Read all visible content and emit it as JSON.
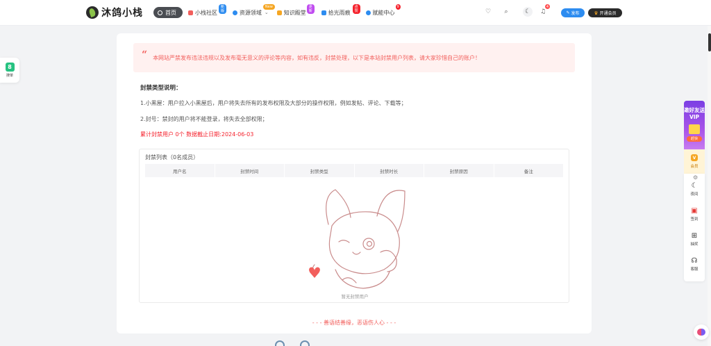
{
  "header": {
    "logo_text": "沐鸽小栈",
    "nav": {
      "home": "首页",
      "items": [
        {
          "label": "小栈社区",
          "badge": "新版",
          "badge_color": "#2d8cf0",
          "dot_color": "#f25f5c"
        },
        {
          "label": "资源领域",
          "badge": "New",
          "badge_color": "#f5a623",
          "dot_color": "#2d8cf0"
        },
        {
          "label": "知识殿堂",
          "badge": "更新",
          "badge_color": "#c04cf0",
          "dot_color": "#f5a623"
        },
        {
          "label": "拾光雨痕",
          "badge": "点赞",
          "badge_color": "#f5222d",
          "dot_color": "#2d8cf0"
        },
        {
          "label": "赋能中心",
          "badge": "9",
          "badge_color": "#f5222d",
          "dot_color": "#2d8cf0"
        }
      ]
    },
    "notification_count": "4",
    "publish_label": "发布",
    "vip_label": "开通会员"
  },
  "left_float": {
    "label": "搜单"
  },
  "main": {
    "notice": "本网站严禁发布违法违规以及发布毫无意义的评论等内容，如有违反，封禁处理，以下是本站封禁用户列表，请大家珍惜自己的账户！",
    "section_title": "封禁类型说明：",
    "lines": [
      "1.小黑屋：用户拉入小黑屋后，用户将失去所有的发布权限及大部分的操作权限，例如发帖、评论、下载等；",
      "2.封号：禁封的用户将不能登录，将失去全部权限；"
    ],
    "summary": "累计封禁用户 0个 数据截止日期:2024-06-03",
    "list": {
      "title": "封禁列表（0名成员）",
      "columns": [
        "用户名",
        "封禁时间",
        "封禁类型",
        "封禁时长",
        "封禁原因",
        "备注"
      ],
      "empty_text": "暂无封禁用户"
    },
    "motto": "- - - 善语结善缘，恶语伤人心 - - -"
  },
  "right_float": {
    "promo_text": "邀好友送VIP",
    "promo_button": "赶快",
    "vip_label": "会员",
    "tools": [
      "夜间",
      "签到",
      "抽奖",
      "客服"
    ]
  }
}
